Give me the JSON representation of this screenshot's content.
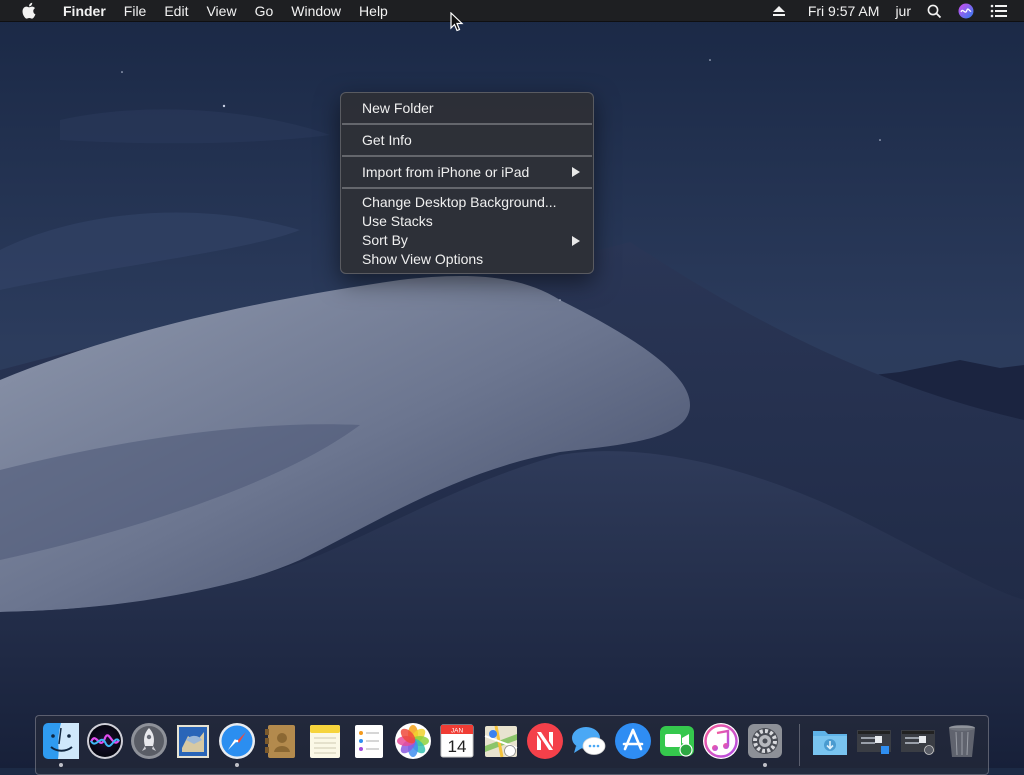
{
  "menubar": {
    "apple_icon": "apple-icon",
    "app_name": "Finder",
    "items": [
      "File",
      "Edit",
      "View",
      "Go",
      "Window",
      "Help"
    ],
    "status": {
      "eject_icon": "eject-icon",
      "clock": "Fri 9:57 AM",
      "user": "jur",
      "search_icon": "spotlight-search-icon",
      "siri_icon": "siri-icon",
      "notification_icon": "notification-center-icon"
    }
  },
  "context_menu": {
    "new_folder": "New Folder",
    "get_info": "Get Info",
    "import": "Import from iPhone or iPad",
    "change_background": "Change Desktop Background...",
    "use_stacks": "Use Stacks",
    "sort_by": "Sort By",
    "show_view_options": "Show View Options"
  },
  "dock": {
    "apps": [
      {
        "name": "Finder",
        "icon": "finder-icon",
        "running": true
      },
      {
        "name": "Siri",
        "icon": "siri-icon",
        "running": false
      },
      {
        "name": "Launchpad",
        "icon": "launchpad-icon",
        "running": false
      },
      {
        "name": "Mail",
        "icon": "mail-icon",
        "running": false
      },
      {
        "name": "Safari",
        "icon": "safari-icon",
        "running": true
      },
      {
        "name": "Contacts",
        "icon": "contacts-icon",
        "running": false
      },
      {
        "name": "Notes",
        "icon": "notes-icon",
        "running": false
      },
      {
        "name": "Reminders",
        "icon": "reminders-icon",
        "running": false
      },
      {
        "name": "Photos",
        "icon": "photos-icon",
        "running": false
      },
      {
        "name": "Calendar",
        "icon": "calendar-icon",
        "running": false
      },
      {
        "name": "Maps",
        "icon": "maps-icon",
        "running": false
      },
      {
        "name": "News",
        "icon": "news-icon",
        "running": false
      },
      {
        "name": "Messages",
        "icon": "messages-icon",
        "running": false
      },
      {
        "name": "App Store",
        "icon": "app-store-icon",
        "running": false
      },
      {
        "name": "FaceTime",
        "icon": "facetime-icon",
        "running": false
      },
      {
        "name": "iTunes",
        "icon": "itunes-icon",
        "running": false
      },
      {
        "name": "System Preferences",
        "icon": "system-preferences-icon",
        "running": true
      }
    ],
    "calendar_month": "JAN",
    "calendar_day": "14",
    "stacks": [
      {
        "name": "Downloads",
        "icon": "downloads-folder-icon"
      },
      {
        "name": "Screenshot stack 1",
        "icon": "screenshot-stack-icon"
      },
      {
        "name": "Screenshot stack 2",
        "icon": "screenshot-stack-icon"
      },
      {
        "name": "Trash",
        "icon": "trash-icon"
      }
    ]
  },
  "colors": {
    "menu_bar_bg": "#1e1e20",
    "context_menu_bg": "#2e3036",
    "wallpaper_sky": "#1c2a45",
    "dune_light": "#8a93a8"
  }
}
